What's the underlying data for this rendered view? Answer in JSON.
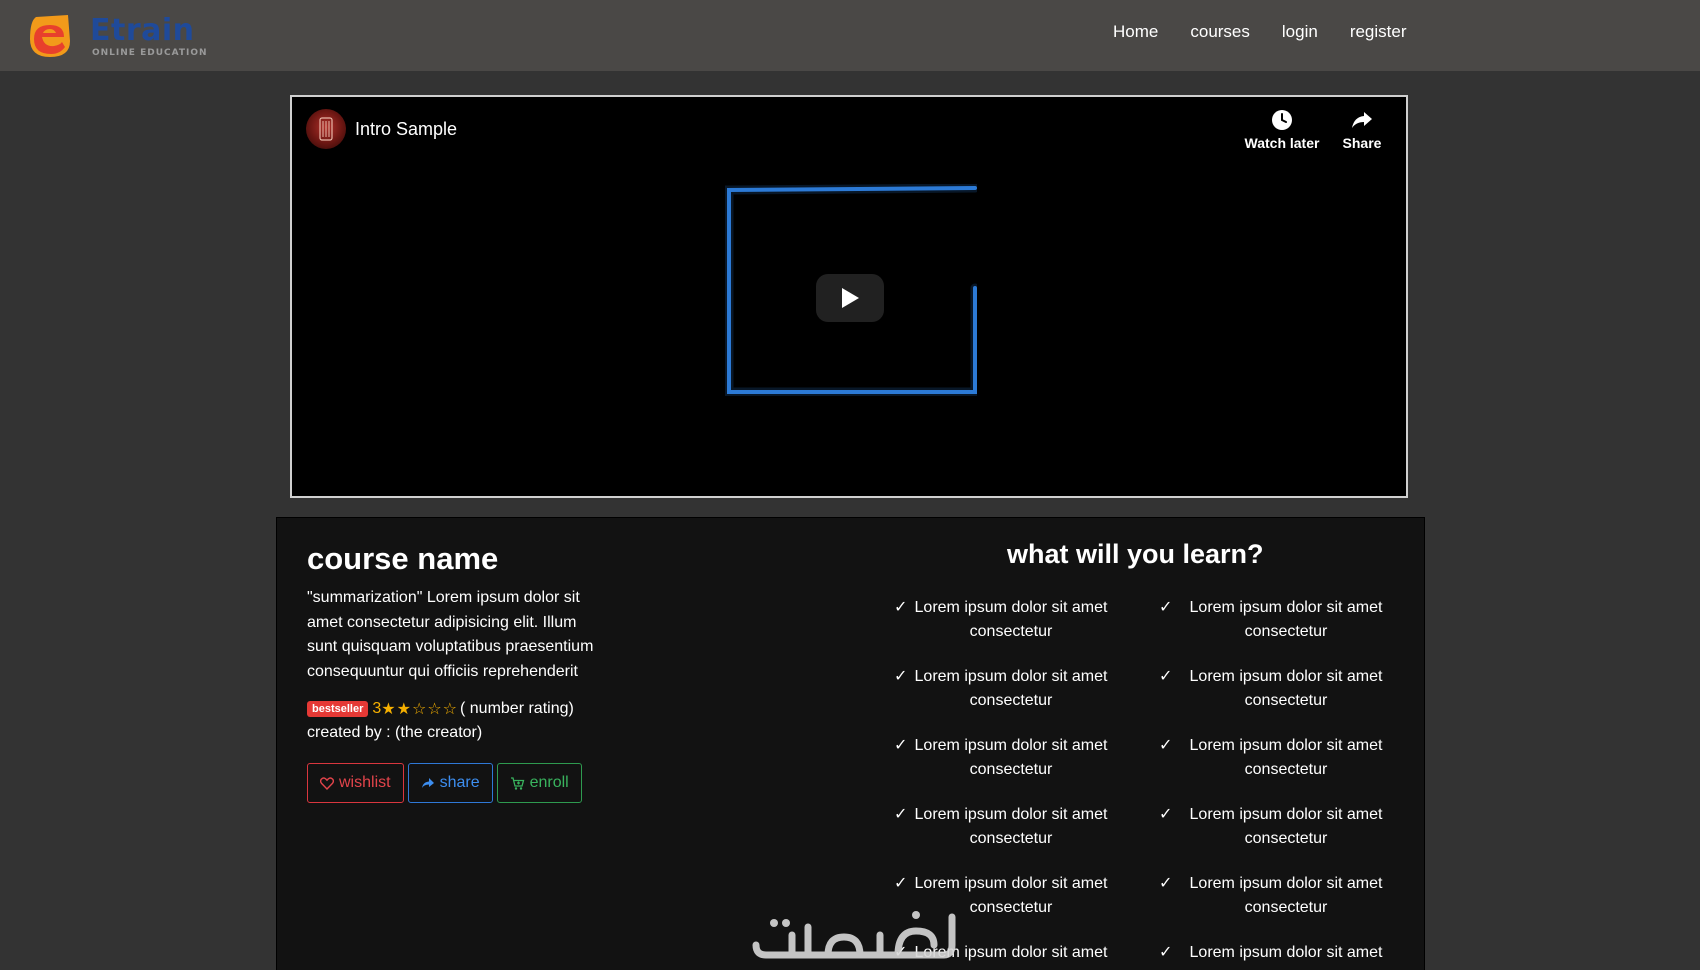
{
  "brand": {
    "name": "Etrain",
    "tagline": "ONLINE EDUCATION",
    "colors": {
      "orange": "#f29a1a",
      "red": "#e8402c",
      "blue": "#1f4a9a"
    }
  },
  "nav": {
    "items": [
      {
        "label": "Home"
      },
      {
        "label": "courses"
      },
      {
        "label": "login"
      },
      {
        "label": "register"
      }
    ]
  },
  "video": {
    "title": "Intro Sample",
    "watch_later_label": "Watch later",
    "share_label": "Share",
    "icons": [
      "clock-icon",
      "share-arrow-icon",
      "play-icon"
    ],
    "thumbnail_color": "#2f7fe0"
  },
  "course": {
    "name": "course name",
    "summary": "\"summarization\" Lorem ipsum dolor sit amet consectetur adipisicing elit. Illum sunt quisquam voluptatibus praesentium consequuntur qui officiis reprehenderit",
    "badge": "bestseller",
    "rating": "3",
    "stars": "★★☆☆☆",
    "rating_label": "( number rating)",
    "created_by": "created by : (the creator)",
    "buttons": {
      "wishlist": "wishlist",
      "share": "share",
      "enroll": "enroll"
    },
    "colors": {
      "wishlist": "#e2444b",
      "share": "#3d8ef0",
      "enroll": "#39b35e",
      "star": "#f6b000",
      "badge": "#e53935"
    }
  },
  "learn": {
    "title": "what will you learn?",
    "check": "✓",
    "items": [
      "Lorem ipsum dolor sit amet consectetur",
      "Lorem ipsum dolor sit amet consectetur",
      "Lorem ipsum dolor sit amet consectetur",
      "Lorem ipsum dolor sit amet consectetur",
      "Lorem ipsum dolor sit amet consectetur",
      "Lorem ipsum dolor sit amet consectetur",
      "Lorem ipsum dolor sit amet consectetur",
      "Lorem ipsum dolor sit amet consectetur",
      "Lorem ipsum dolor sit amet consectetur",
      "Lorem ipsum dolor sit amet consectetur",
      "Lorem ipsum dolor sit amet",
      "Lorem ipsum dolor sit amet"
    ]
  },
  "watermark": {
    "text": "خمسات"
  }
}
